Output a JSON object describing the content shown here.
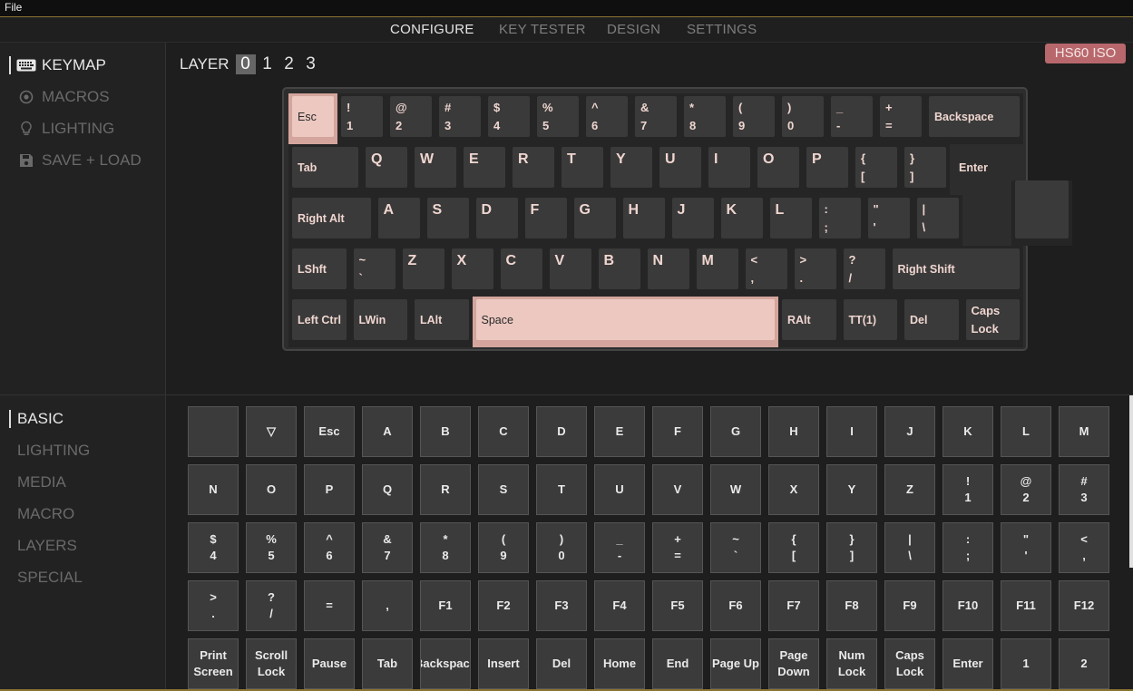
{
  "menu": {
    "file": "File"
  },
  "topnav": {
    "tabs": [
      "CONFIGURE",
      "KEY TESTER",
      "DESIGN",
      "SETTINGS"
    ],
    "active": "CONFIGURE"
  },
  "sidebar": {
    "items": [
      {
        "label": "KEYMAP",
        "icon": "keyboard-icon",
        "active": true
      },
      {
        "label": "MACROS",
        "icon": "radio-target-icon",
        "active": false
      },
      {
        "label": "LIGHTING",
        "icon": "lightbulb-icon",
        "active": false
      },
      {
        "label": "SAVE + LOAD",
        "icon": "floppy-disk-icon",
        "active": false
      }
    ]
  },
  "layers": {
    "label": "LAYER",
    "numbers": [
      "0",
      "1",
      "2",
      "3"
    ],
    "selected": "0"
  },
  "board": {
    "name": "HS60 ISO",
    "badge_color": "#b8686c"
  },
  "keyboard": {
    "rows": [
      [
        {
          "l": [
            "Esc"
          ],
          "sel": true
        },
        {
          "l": [
            "!",
            "1"
          ]
        },
        {
          "l": [
            "@",
            "2"
          ]
        },
        {
          "l": [
            "#",
            "3"
          ]
        },
        {
          "l": [
            "$",
            "4"
          ]
        },
        {
          "l": [
            "%",
            "5"
          ]
        },
        {
          "l": [
            "^",
            "6"
          ]
        },
        {
          "l": [
            "&",
            "7"
          ]
        },
        {
          "l": [
            "*",
            "8"
          ]
        },
        {
          "l": [
            "(",
            "9"
          ]
        },
        {
          "l": [
            ")",
            "0"
          ]
        },
        {
          "l": [
            "_",
            "-"
          ]
        },
        {
          "l": [
            "+",
            "="
          ]
        },
        {
          "l": [
            "Backspace"
          ]
        }
      ],
      [
        {
          "l": [
            "Tab"
          ]
        },
        {
          "l": [
            "Q"
          ]
        },
        {
          "l": [
            "W"
          ]
        },
        {
          "l": [
            "E"
          ]
        },
        {
          "l": [
            "R"
          ]
        },
        {
          "l": [
            "T"
          ]
        },
        {
          "l": [
            "Y"
          ]
        },
        {
          "l": [
            "U"
          ]
        },
        {
          "l": [
            "I"
          ]
        },
        {
          "l": [
            "O"
          ]
        },
        {
          "l": [
            "P"
          ]
        },
        {
          "l": [
            "{",
            "["
          ]
        },
        {
          "l": [
            "}",
            "]"
          ]
        },
        {
          "l": [
            "Enter"
          ]
        }
      ],
      [
        {
          "l": [
            "Right Alt"
          ]
        },
        {
          "l": [
            "A"
          ]
        },
        {
          "l": [
            "S"
          ]
        },
        {
          "l": [
            "D"
          ]
        },
        {
          "l": [
            "F"
          ]
        },
        {
          "l": [
            "G"
          ]
        },
        {
          "l": [
            "H"
          ]
        },
        {
          "l": [
            "J"
          ]
        },
        {
          "l": [
            "K"
          ]
        },
        {
          "l": [
            "L"
          ]
        },
        {
          "l": [
            ":",
            ";"
          ]
        },
        {
          "l": [
            "\"",
            "'"
          ]
        },
        {
          "l": [
            "|",
            "\\"
          ]
        }
      ],
      [
        {
          "l": [
            "LShft"
          ]
        },
        {
          "l": [
            "~",
            "`"
          ]
        },
        {
          "l": [
            "Z"
          ]
        },
        {
          "l": [
            "X"
          ]
        },
        {
          "l": [
            "C"
          ]
        },
        {
          "l": [
            "V"
          ]
        },
        {
          "l": [
            "B"
          ]
        },
        {
          "l": [
            "N"
          ]
        },
        {
          "l": [
            "M"
          ]
        },
        {
          "l": [
            "<",
            ","
          ]
        },
        {
          "l": [
            ">",
            "."
          ]
        },
        {
          "l": [
            "?",
            "/"
          ]
        },
        {
          "l": [
            "Right Shift"
          ]
        }
      ],
      [
        {
          "l": [
            "Left Ctrl"
          ]
        },
        {
          "l": [
            "LWin"
          ]
        },
        {
          "l": [
            "LAlt"
          ]
        },
        {
          "l": [
            "Space"
          ],
          "sel": true
        },
        {
          "l": [
            "RAlt"
          ]
        },
        {
          "l": [
            "TT(1)"
          ]
        },
        {
          "l": [
            "Del"
          ]
        },
        {
          "l": [
            "Caps",
            "Lock"
          ]
        }
      ]
    ]
  },
  "categories": {
    "items": [
      "BASIC",
      "LIGHTING",
      "MEDIA",
      "MACRO",
      "LAYERS",
      "SPECIAL"
    ],
    "active": "BASIC"
  },
  "picker": {
    "rows": [
      [
        [
          ""
        ],
        [
          "▽"
        ],
        [
          "Esc"
        ],
        [
          "A"
        ],
        [
          "B"
        ],
        [
          "C"
        ],
        [
          "D"
        ],
        [
          "E"
        ],
        [
          "F"
        ],
        [
          "G"
        ],
        [
          "H"
        ],
        [
          "I"
        ],
        [
          "J"
        ],
        [
          "K"
        ],
        [
          "L"
        ],
        [
          "M"
        ]
      ],
      [
        [
          "N"
        ],
        [
          "O"
        ],
        [
          "P"
        ],
        [
          "Q"
        ],
        [
          "R"
        ],
        [
          "S"
        ],
        [
          "T"
        ],
        [
          "U"
        ],
        [
          "V"
        ],
        [
          "W"
        ],
        [
          "X"
        ],
        [
          "Y"
        ],
        [
          "Z"
        ],
        [
          "!",
          "1"
        ],
        [
          "@",
          "2"
        ],
        [
          "#",
          "3"
        ]
      ],
      [
        [
          "$",
          "4"
        ],
        [
          "%",
          "5"
        ],
        [
          "^",
          "6"
        ],
        [
          "&",
          "7"
        ],
        [
          "*",
          "8"
        ],
        [
          "(",
          "9"
        ],
        [
          ")",
          "0"
        ],
        [
          "_",
          "-"
        ],
        [
          "+",
          "="
        ],
        [
          "~",
          "`"
        ],
        [
          "{",
          "["
        ],
        [
          "}",
          "]"
        ],
        [
          "|",
          "\\"
        ],
        [
          ":",
          ";"
        ],
        [
          "\"",
          "'"
        ],
        [
          "<",
          ","
        ]
      ],
      [
        [
          ">",
          "."
        ],
        [
          "?",
          "/"
        ],
        [
          "="
        ],
        [
          ","
        ],
        [
          "F1"
        ],
        [
          "F2"
        ],
        [
          "F3"
        ],
        [
          "F4"
        ],
        [
          "F5"
        ],
        [
          "F6"
        ],
        [
          "F7"
        ],
        [
          "F8"
        ],
        [
          "F9"
        ],
        [
          "F10"
        ],
        [
          "F11"
        ],
        [
          "F12"
        ]
      ],
      [
        [
          "Print",
          "Screen"
        ],
        [
          "Scroll",
          "Lock"
        ],
        [
          "Pause"
        ],
        [
          "Tab"
        ],
        [
          "Backspace"
        ],
        [
          "Insert"
        ],
        [
          "Del"
        ],
        [
          "Home"
        ],
        [
          "End"
        ],
        [
          "Page Up"
        ],
        [
          "Page",
          "Down"
        ],
        [
          "Num",
          "Lock"
        ],
        [
          "Caps",
          "Lock"
        ],
        [
          "Enter"
        ],
        [
          "1"
        ],
        [
          "2"
        ]
      ]
    ]
  },
  "colors": {
    "accent_gold": "#8a7432",
    "selected_key": "#ecc8c0",
    "key_cap": "#3a3a3a"
  }
}
